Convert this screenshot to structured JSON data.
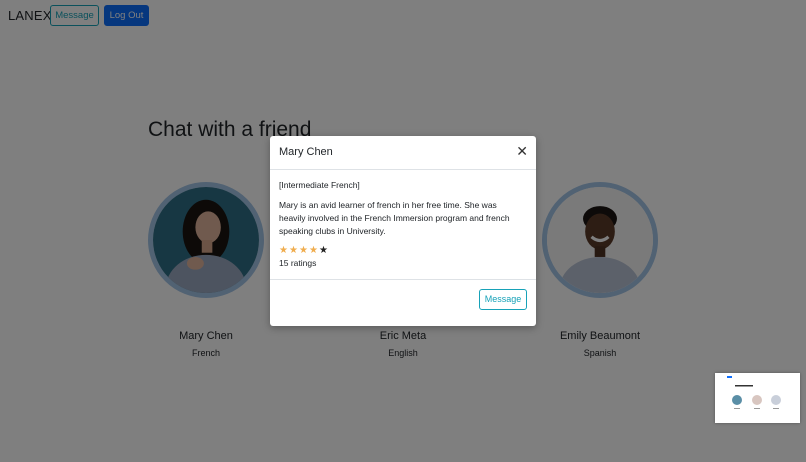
{
  "navbar": {
    "brand": "LANEX",
    "message_label": "Message",
    "logout_label": "Log Out"
  },
  "page": {
    "heading": "Chat with a friend"
  },
  "friends": [
    {
      "name": "Mary Chen",
      "language": "French"
    },
    {
      "name": "Eric Meta",
      "language": "English"
    },
    {
      "name": "Emily Beaumont",
      "language": "Spanish"
    }
  ],
  "modal": {
    "title": "Mary Chen",
    "level": "[Intermediate French]",
    "description": "Mary is an avid learner of french in her free time. She was heavily involved in the French Immersion program and french speaking clubs in University.",
    "rating": 4,
    "rating_max": 5,
    "ratings_count": "15 ratings",
    "close_icon": "close-icon",
    "message_label": "Message"
  },
  "colors": {
    "primary": "#0d6efd",
    "info": "#17a2b8",
    "star": "#f0ad4e",
    "avatar_border": "#a3c4e6"
  }
}
